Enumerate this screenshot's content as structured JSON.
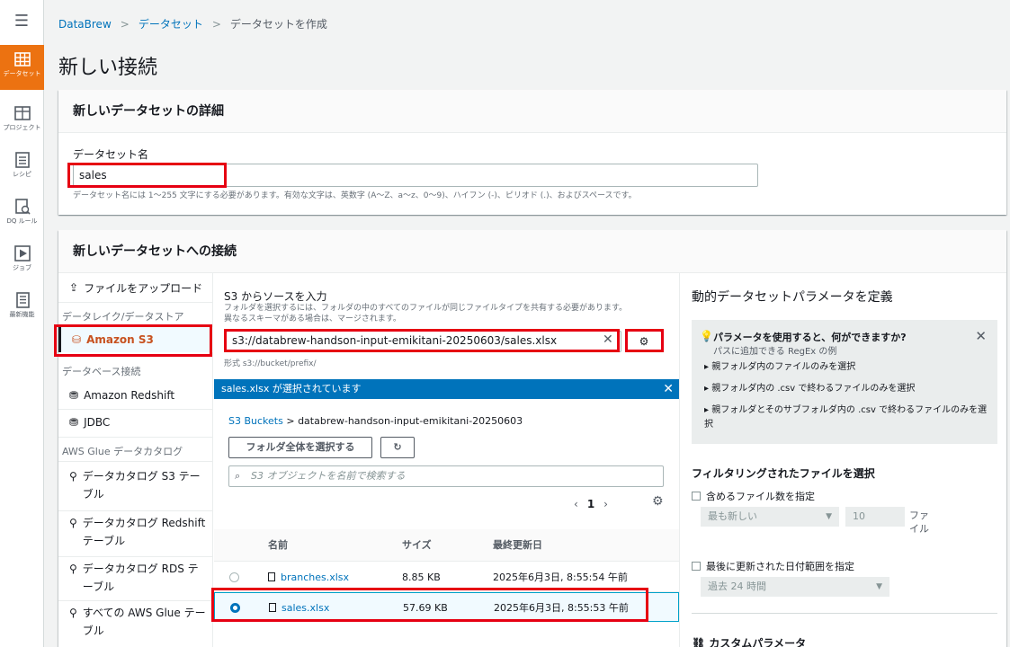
{
  "rail": {
    "items": [
      {
        "label": "データセット",
        "icon": "grid-icon"
      },
      {
        "label": "プロジェクト",
        "icon": "table-icon"
      },
      {
        "label": "レシピ",
        "icon": "list-icon"
      },
      {
        "label": "DQ ルール",
        "icon": "rules-icon"
      },
      {
        "label": "ジョブ",
        "icon": "play-icon"
      },
      {
        "label": "最新機能",
        "icon": "news-icon"
      }
    ]
  },
  "breadcrumb": {
    "root": "DataBrew",
    "parent": "データセット",
    "current": "データセットを作成"
  },
  "page_title": "新しい接続",
  "details": {
    "header": "新しいデータセットの詳細",
    "name_label": "データセット名",
    "name_value": "sales",
    "hint": "データセット名には 1〜255 文字にする必要があります。有効な文字は、英数字 (A〜Z、a〜z、0〜9)、ハイフン (-)、ピリオド (.)、およびスペースです。"
  },
  "connection": {
    "header": "新しいデータセットへの接続",
    "nav": {
      "upload": "ファイルをアップロード",
      "group_lake": "データレイク/データストア",
      "s3": "Amazon S3",
      "group_db": "データベース接続",
      "redshift": "Amazon Redshift",
      "jdbc": "JDBC",
      "group_glue": "AWS Glue データカタログ",
      "cat_s3": "データカタログ S3 テーブル",
      "cat_redshift": "データカタログ Redshift テーブル",
      "cat_rds": "データカタログ RDS テーブル",
      "cat_all": "すべての AWS Glue テーブル"
    },
    "s3": {
      "title": "S3 からソースを入力",
      "desc1": "フォルダを選択するには、フォルダの中のすべてのファイルが同じファイルタイプを共有する必要があります。",
      "desc2": "異なるスキーマがある場合は、マージされます。",
      "path_value": "s3://databrew-handson-input-emikitani-20250603/sales.xlsx",
      "format_hint": "形式 s3://bucket/prefix/",
      "selected_banner": "sales.xlsx が選択されています",
      "buckets_link": "S3 Buckets",
      "bucket_name": "databrew-handson-input-emikitani-20250603",
      "select_all_button": "フォルダ全体を選択する",
      "search_placeholder": "S3 オブジェクトを名前で検索する",
      "page": "1",
      "columns": {
        "name": "名前",
        "size": "サイズ",
        "modified": "最終更新日"
      },
      "rows": [
        {
          "name": "branches.xlsx",
          "size": "8.85 KB",
          "modified": "2025年6月3日, 8:55:54 午前",
          "selected": false
        },
        {
          "name": "sales.xlsx",
          "size": "57.69 KB",
          "modified": "2025年6月3日, 8:55:53 午前",
          "selected": true
        }
      ]
    },
    "params": {
      "title": "動的データセットパラメータを定義",
      "info_question": "パラメータを使用すると、何ができますか?",
      "info_sub": "パスに追加できる RegEx の例",
      "info_items": [
        "親フォルダ内のファイルのみを選択",
        "親フォルダ内の .csv で終わるファイルのみを選択",
        "親フォルダとそのサブフォルダ内の .csv で終わるファイルのみを選択"
      ],
      "filter_title": "フィルタリングされたファイルを選択",
      "count_check": "含めるファイル数を指定",
      "count_order": "最も新しい",
      "count_value": "10",
      "count_unit": "ファイル",
      "date_check": "最後に更新された日付範囲を指定",
      "date_range": "過去 24 時間",
      "custom_title": "カスタムパラメータ"
    }
  }
}
